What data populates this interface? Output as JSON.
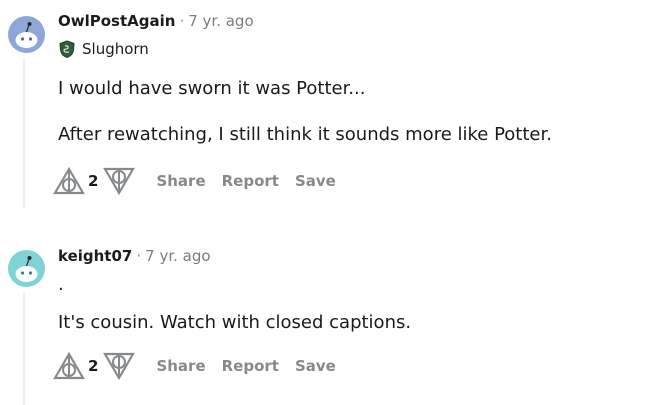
{
  "comments": [
    {
      "author": "OwlPostAgain",
      "separator": "·",
      "age": "7 yr. ago",
      "flair": "Slughorn",
      "paragraphs": [
        "I would have sworn it was Potter...",
        "After rewatching, I still think it sounds more like Potter."
      ],
      "score": "2",
      "actions": {
        "share": "Share",
        "report": "Report",
        "save": "Save"
      },
      "avatar_color": "#8fa6d8"
    },
    {
      "author": "keight07",
      "separator": "·",
      "age": "7 yr. ago",
      "paragraphs": [
        ".",
        "It's cousin. Watch with closed captions."
      ],
      "score": "2",
      "actions": {
        "share": "Share",
        "report": "Report",
        "save": "Save"
      },
      "avatar_color": "#7fd3d6"
    }
  ],
  "colors": {
    "action_gray": "#878a8c",
    "thread_line": "#edeff1",
    "flair_badge": "#2e5e3a"
  }
}
